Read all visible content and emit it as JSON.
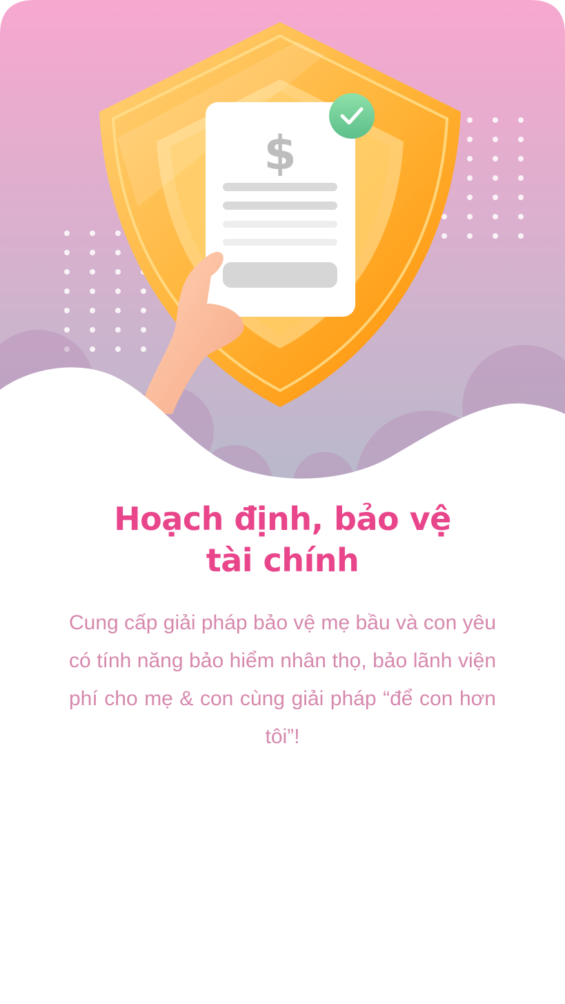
{
  "onboarding": {
    "title_line1": "Hoạch định, bảo vệ",
    "title_line2": "tài chính",
    "description": "Cung cấp giải pháp bảo vệ mẹ bầu và con yêu có tính năng bảo hiểm nhân thọ, bảo lãnh viện phí cho mẹ & con cùng giải pháp “để con hơn tôi”!",
    "illustration": {
      "shield_icon": "shield-icon",
      "document_icon": "invoice-document-icon",
      "check_icon": "check-badge-icon",
      "currency_symbol": "$"
    }
  },
  "colors": {
    "title": "#e8458b",
    "description": "#d688ad",
    "gradient_top": "#f7a8cf",
    "gradient_bottom": "#b9b9cc",
    "shield": "#ffb234",
    "check": "#6fcf97"
  }
}
